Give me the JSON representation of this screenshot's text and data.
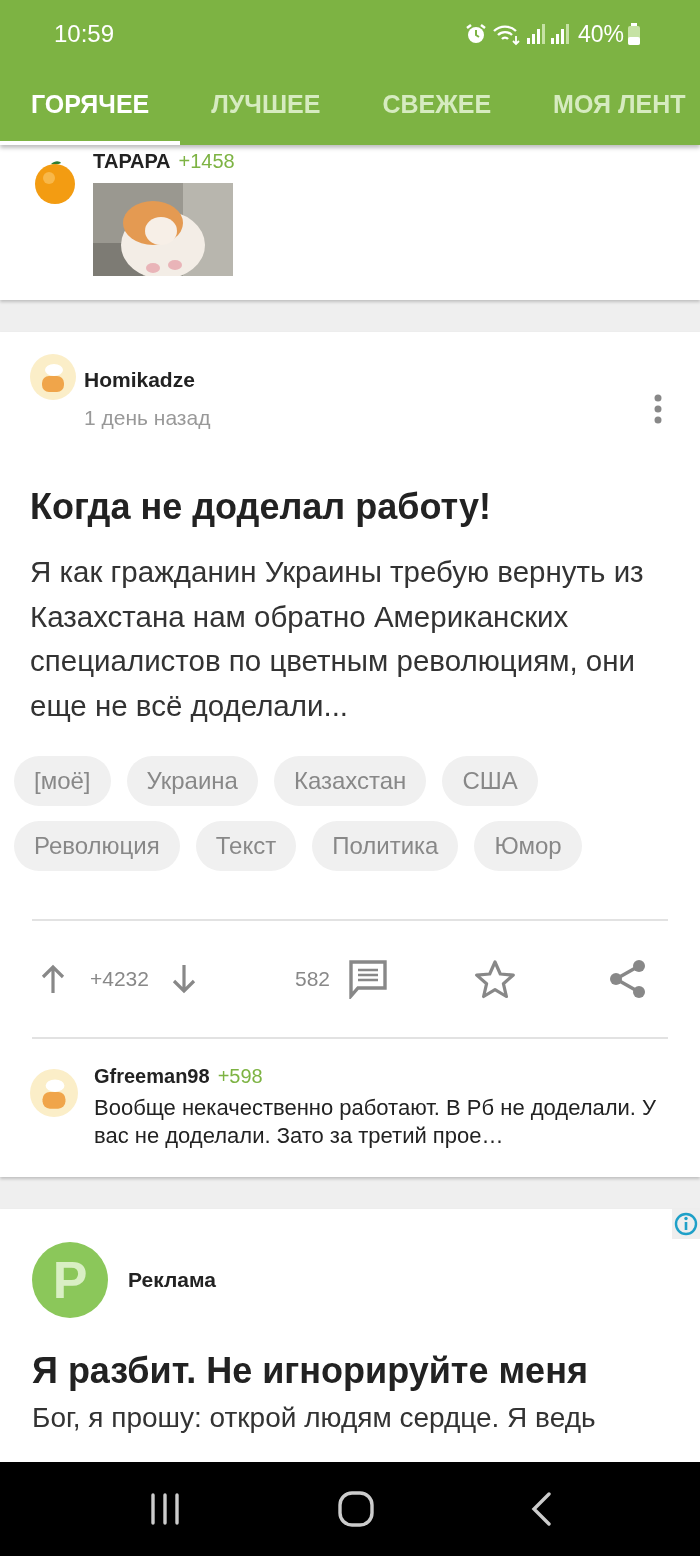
{
  "status_bar": {
    "time": "10:59",
    "battery": "40%"
  },
  "tabs": [
    {
      "label": "ГОРЯЧЕЕ",
      "selected": true
    },
    {
      "label": "ЛУЧШЕЕ",
      "selected": false
    },
    {
      "label": "СВЕЖЕЕ",
      "selected": false
    },
    {
      "label": "МОЯ ЛЕНТ",
      "selected": false
    }
  ],
  "previous_comment": {
    "author": "ТАРАРА",
    "rating": "+1458"
  },
  "post": {
    "author": "Homikadze",
    "time": "1 день назад",
    "title": "Когда не доделал работу!",
    "body": "Я как гражданин Украины требую вернуть из Казахстана нам обратно Американских специалистов по цветным революциям, они еще не всё доделали...",
    "tags": [
      "[моё]",
      "Украина",
      "Казахстан",
      "США",
      "Революция",
      "Текст",
      "Политика",
      "Юмор"
    ],
    "votes": "+4232",
    "comments": "582",
    "top_comment": {
      "author": "Gfreeman98",
      "rating": "+598",
      "text": "Вообще некачественно работают. В Рб не доделали. У вас не доделали. Зато за третий прое…"
    }
  },
  "ad": {
    "avatar_letter": "P",
    "label": "Реклама",
    "title": "Я разбит. Не игнорируйте меня",
    "body": "Бог, я прошу: открой людям сердце. Я ведь"
  }
}
